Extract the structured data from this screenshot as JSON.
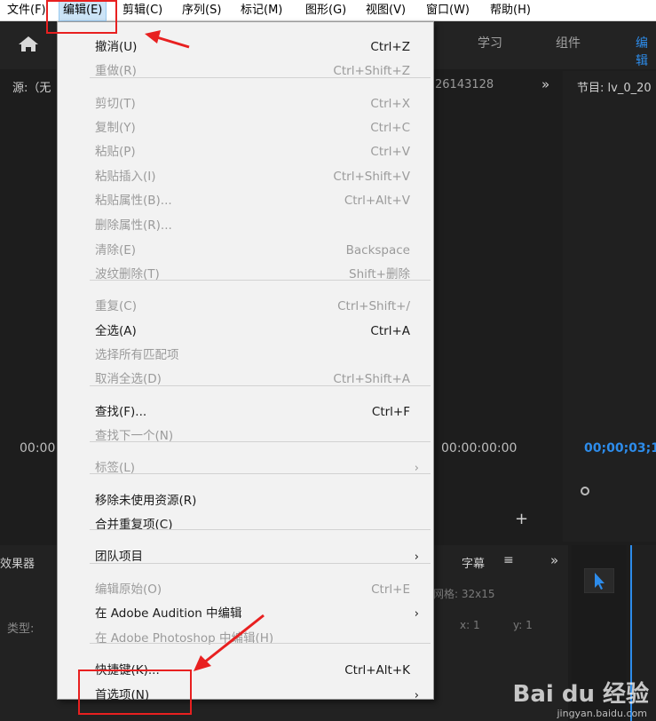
{
  "menubar": {
    "items": [
      "文件(F)",
      "编辑(E)",
      "剪辑(C)",
      "序列(S)",
      "标记(M)",
      "图形(G)",
      "视图(V)",
      "窗口(W)",
      "帮助(H)"
    ]
  },
  "workspace_tabs": [
    "学习",
    "组件",
    "编辑"
  ],
  "source_panel": {
    "title": "源:（无",
    "timecode_left": "00:00",
    "clip_id": "26143128",
    "timecode": "00:00:00:00"
  },
  "program_panel": {
    "title": "节目: lv_0_20",
    "timecode": "00;00;03;1"
  },
  "lower_panels": {
    "effects_title": "效果器",
    "type_label": "类型:",
    "captions_title": "字幕",
    "grid_label": "网格: 32x15",
    "x_label": "x: 1",
    "y_label": "y: 1"
  },
  "menu": {
    "items": [
      {
        "label": "撤消(U)",
        "shortcut": "Ctrl+Z",
        "disabled": false
      },
      {
        "label": "重做(R)",
        "shortcut": "Ctrl+Shift+Z",
        "disabled": true
      },
      {
        "label": "剪切(T)",
        "shortcut": "Ctrl+X",
        "disabled": true
      },
      {
        "label": "复制(Y)",
        "shortcut": "Ctrl+C",
        "disabled": true
      },
      {
        "label": "粘贴(P)",
        "shortcut": "Ctrl+V",
        "disabled": true
      },
      {
        "label": "粘贴插入(I)",
        "shortcut": "Ctrl+Shift+V",
        "disabled": true
      },
      {
        "label": "粘贴属性(B)...",
        "shortcut": "Ctrl+Alt+V",
        "disabled": true
      },
      {
        "label": "删除属性(R)...",
        "shortcut": "",
        "disabled": true
      },
      {
        "label": "清除(E)",
        "shortcut": "Backspace",
        "disabled": true
      },
      {
        "label": "波纹删除(T)",
        "shortcut": "Shift+删除",
        "disabled": true
      },
      {
        "label": "重复(C)",
        "shortcut": "Ctrl+Shift+/",
        "disabled": true
      },
      {
        "label": "全选(A)",
        "shortcut": "Ctrl+A",
        "disabled": false
      },
      {
        "label": "选择所有匹配项",
        "shortcut": "",
        "disabled": true
      },
      {
        "label": "取消全选(D)",
        "shortcut": "Ctrl+Shift+A",
        "disabled": true
      },
      {
        "label": "查找(F)...",
        "shortcut": "Ctrl+F",
        "disabled": false
      },
      {
        "label": "查找下一个(N)",
        "shortcut": "",
        "disabled": true
      },
      {
        "label": "标签(L)",
        "shortcut": "",
        "disabled": true,
        "submenu": true
      },
      {
        "label": "移除未使用资源(R)",
        "shortcut": "",
        "disabled": false
      },
      {
        "label": "合并重复项(C)",
        "shortcut": "",
        "disabled": false
      },
      {
        "label": "团队项目",
        "shortcut": "",
        "disabled": false,
        "submenu": true
      },
      {
        "label": "编辑原始(O)",
        "shortcut": "Ctrl+E",
        "disabled": true
      },
      {
        "label": "在 Adobe Audition 中编辑",
        "shortcut": "",
        "disabled": false,
        "submenu": true
      },
      {
        "label": "在 Adobe Photoshop 中编辑(H)",
        "shortcut": "",
        "disabled": true
      },
      {
        "label": "快捷键(K)...",
        "shortcut": "Ctrl+Alt+K",
        "disabled": false
      },
      {
        "label": "首选项(N)",
        "shortcut": "",
        "disabled": false,
        "submenu": true
      }
    ]
  },
  "watermark": {
    "brand": "Bai du 经验",
    "url": "jingyan.baidu.com"
  },
  "colors": {
    "annotation": "#e82020",
    "accent": "#2d8ceb"
  }
}
